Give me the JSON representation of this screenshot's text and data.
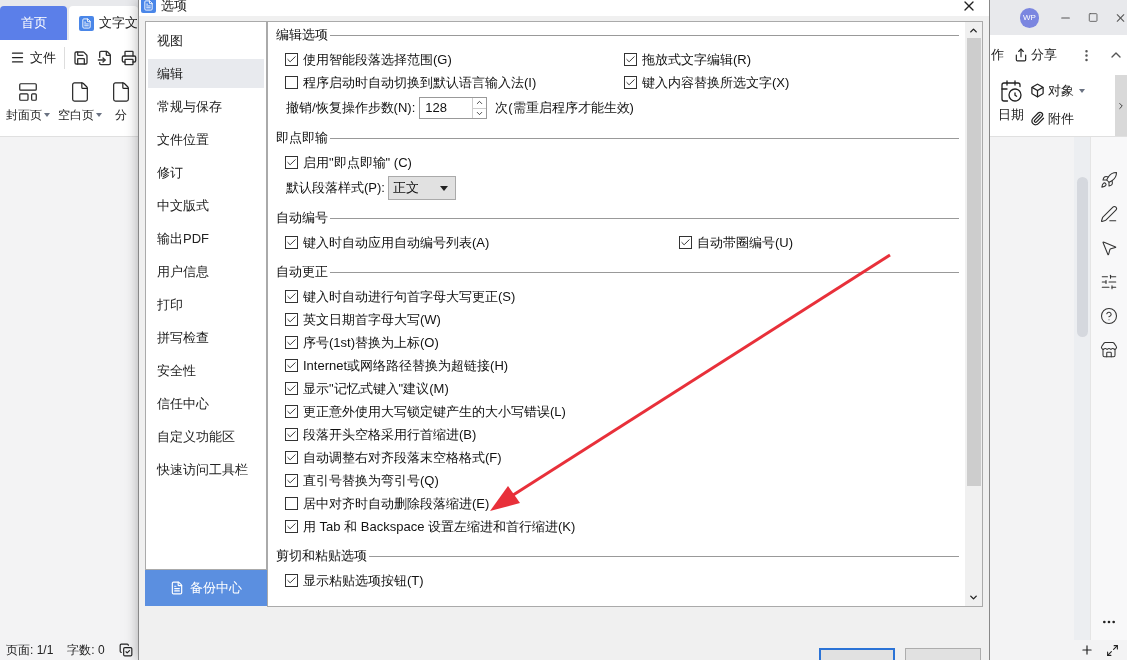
{
  "app": {
    "tabs": [
      {
        "label": "首页",
        "selected": true
      },
      {
        "label": "文字文",
        "selected": false
      }
    ],
    "menu_label": "文件",
    "ribbon_left": [
      {
        "label": "封面页",
        "dropdown": true
      },
      {
        "label": "空白页",
        "dropdown": true
      },
      {
        "label": "分",
        "dropdown": false
      }
    ],
    "avatar": "WP",
    "toolbar_right": {
      "cut_label": "作",
      "share": "分享"
    },
    "ribbon_right": {
      "object": "对象",
      "date": "日期",
      "attachment": "附件"
    },
    "status": [
      "页面: 1/1",
      "字数: 0"
    ]
  },
  "dialog": {
    "title": "选项",
    "nav": [
      {
        "label": "视图",
        "selected": false
      },
      {
        "label": "编辑",
        "selected": true
      },
      {
        "label": "常规与保存",
        "selected": false
      },
      {
        "label": "文件位置",
        "selected": false
      },
      {
        "label": "修订",
        "selected": false
      },
      {
        "label": "中文版式",
        "selected": false
      },
      {
        "label": "输出PDF",
        "selected": false
      },
      {
        "label": "用户信息",
        "selected": false
      },
      {
        "label": "打印",
        "selected": false
      },
      {
        "label": "拼写检查",
        "selected": false
      },
      {
        "label": "安全性",
        "selected": false
      },
      {
        "label": "信任中心",
        "selected": false
      },
      {
        "label": "自定义功能区",
        "selected": false
      },
      {
        "label": "快速访问工具栏",
        "selected": false
      }
    ],
    "backup_button": "备份中心",
    "sections": [
      {
        "title": "编辑选项",
        "rows": [
          [
            {
              "kind": "checkbox",
              "label": "使用智能段落选择范围(G)",
              "checked": true
            },
            {
              "kind": "checkbox",
              "label": "拖放式文字编辑(R)",
              "checked": true
            }
          ],
          [
            {
              "kind": "checkbox",
              "label": "程序启动时自动切换到默认语言输入法(I)",
              "checked": false
            },
            {
              "kind": "checkbox",
              "label": "键入内容替换所选文字(X)",
              "checked": true
            }
          ],
          [
            {
              "kind": "spinner",
              "label": "撤销/恢复操作步数(N):",
              "value": "128",
              "note": "次(需重启程序才能生效)"
            }
          ]
        ]
      },
      {
        "title": "即点即输",
        "rows": [
          [
            {
              "kind": "checkbox",
              "label": "启用\"即点即输\" (C)",
              "checked": true
            }
          ],
          [
            {
              "kind": "dropdown",
              "label": "默认段落样式(P):",
              "value": "正文"
            }
          ]
        ]
      },
      {
        "title": "自动编号",
        "rows": [
          [
            {
              "kind": "checkbox",
              "label": "键入时自动应用自动编号列表(A)",
              "checked": true
            },
            {
              "kind": "checkbox",
              "label": "自动带圈编号(U)",
              "checked": true
            }
          ]
        ]
      },
      {
        "title": "自动更正",
        "rows": [
          [
            {
              "kind": "checkbox",
              "label": "键入时自动进行句首字母大写更正(S)",
              "checked": true
            }
          ],
          [
            {
              "kind": "checkbox",
              "label": "英文日期首字母大写(W)",
              "checked": true
            }
          ],
          [
            {
              "kind": "checkbox",
              "label": "序号(1st)替换为上标(O)",
              "checked": true
            }
          ],
          [
            {
              "kind": "checkbox",
              "label": "Internet或网络路径替换为超链接(H)",
              "checked": true
            }
          ],
          [
            {
              "kind": "checkbox",
              "label": "显示\"记忆式键入\"建议(M)",
              "checked": true
            }
          ],
          [
            {
              "kind": "checkbox",
              "label": "更正意外使用大写锁定键产生的大小写错误(L)",
              "checked": true
            }
          ],
          [
            {
              "kind": "checkbox",
              "label": "段落开头空格采用行首缩进(B)",
              "checked": true
            }
          ],
          [
            {
              "kind": "checkbox",
              "label": "自动调整右对齐段落末空格格式(F)",
              "checked": true
            }
          ],
          [
            {
              "kind": "checkbox",
              "label": "直引号替换为弯引号(Q)",
              "checked": true
            }
          ],
          [
            {
              "kind": "checkbox",
              "label": "居中对齐时自动删除段落缩进(E)",
              "checked": false
            }
          ],
          [
            {
              "kind": "checkbox",
              "label": "用 Tab 和 Backspace 设置左缩进和首行缩进(K)",
              "checked": true
            }
          ]
        ]
      },
      {
        "title": "剪切和粘贴选项",
        "rows": [
          [
            {
              "kind": "checkbox",
              "label": "显示粘贴选项按钮(T)",
              "checked": true
            }
          ]
        ]
      }
    ]
  }
}
